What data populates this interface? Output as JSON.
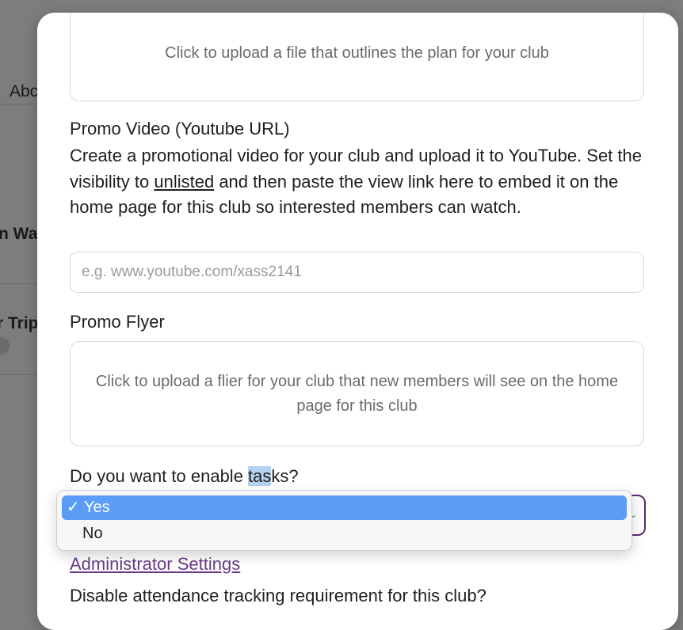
{
  "background": {
    "texts": [
      "Abc",
      "n Wa",
      "r Trip"
    ]
  },
  "modal": {
    "plan_upload": {
      "prompt": "Click to upload a file that outlines the plan for your club"
    },
    "promo_video": {
      "label": "Promo Video (Youtube URL)",
      "desc_part1": "Create a promotional video for your club and upload it to YouTube. Set the visibility to ",
      "desc_link": "unlisted",
      "desc_part2": " and then paste the view link here to embed it on the home page for this club so interested members can watch.",
      "placeholder": "e.g. www.youtube.com/xass2141",
      "value": ""
    },
    "promo_flyer": {
      "label": "Promo Flyer",
      "prompt": "Click to upload a flier for your club that new members will see on the home page for this club"
    },
    "tasks": {
      "label_before": "Do you want to enable ",
      "label_highlight": "tas",
      "label_after": "ks?",
      "selected": "Yes",
      "options": [
        "Yes",
        "No"
      ],
      "check": "✓",
      "chevron": "⌄"
    },
    "admin_settings_link": "Administrator Settings",
    "attendance_label": "Disable attendance tracking requirement for this club?"
  },
  "colors": {
    "accent": "#5a2a6e",
    "link": "#6a3a8a",
    "selected_option": "#5b9cf6",
    "overlay": "#7d7d7d"
  }
}
